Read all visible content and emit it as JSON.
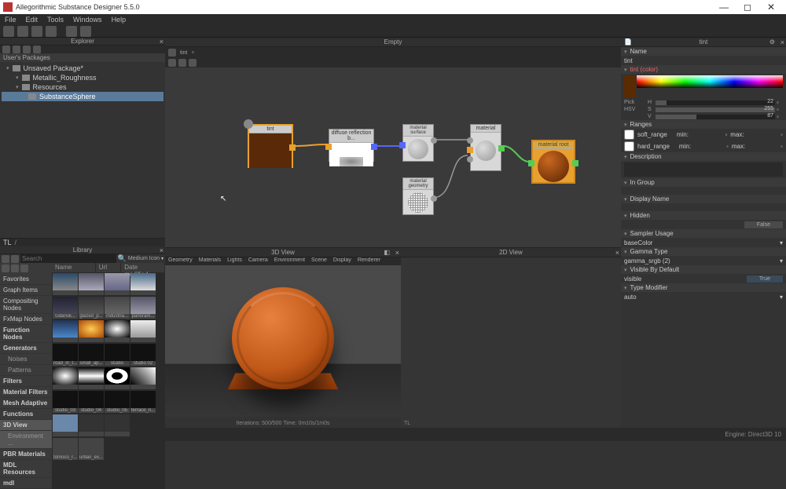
{
  "app": {
    "title": "Allegorithmic Substance Designer 5.5.0"
  },
  "menu": [
    "File",
    "Edit",
    "Tools",
    "Windows",
    "Help"
  ],
  "explorer": {
    "title": "Explorer",
    "section": "User's Packages",
    "items": [
      {
        "label": "Unsaved Package*",
        "level": 1
      },
      {
        "label": "Metallic_Roughness",
        "level": 2
      },
      {
        "label": "Resources",
        "level": 2
      },
      {
        "label": "SubstanceSphere",
        "level": 3,
        "selected": true
      }
    ],
    "tl_label": "TL"
  },
  "library": {
    "title": "Library",
    "search_placeholder": "Search",
    "view_mode": "Medium Icon",
    "columns": [
      "Name",
      "Url",
      "Date modified"
    ],
    "cats": [
      {
        "label": "Favorites"
      },
      {
        "label": "Graph Items"
      },
      {
        "label": "Compositing Nodes"
      },
      {
        "label": "FxMap Nodes"
      },
      {
        "label": "Function Nodes",
        "bold": true
      },
      {
        "label": "Generators",
        "bold": true
      },
      {
        "label": "Noises",
        "sub": true
      },
      {
        "label": "Patterns",
        "sub": true
      },
      {
        "label": "Filters",
        "bold": true
      },
      {
        "label": "Material Filters",
        "bold": true
      },
      {
        "label": "Mesh Adaptive",
        "bold": true
      },
      {
        "label": "Functions",
        "bold": true
      },
      {
        "label": "3D View",
        "bold": true,
        "sel": true
      },
      {
        "label": "Environment ...",
        "sub": true,
        "sel": true
      },
      {
        "label": "PBR Materials",
        "bold": true
      },
      {
        "label": "MDL Resources",
        "bold": true
      },
      {
        "label": "mdl",
        "bold": true
      }
    ],
    "rows": [
      [
        {
          "bg": "linear-gradient(#2a4a6a,#888)",
          "lbl": ""
        },
        {
          "bg": "linear-gradient(#556,#aab)",
          "lbl": ""
        },
        {
          "bg": "linear-gradient(#99a,#668)",
          "lbl": ""
        },
        {
          "bg": "linear-gradient(#4a6a8a,#ddd)",
          "lbl": ""
        }
      ],
      [
        {
          "bg": "linear-gradient(#223,#445)",
          "lbl": "Gdansk..."
        },
        {
          "bg": "linear-gradient(#333,#555)",
          "lbl": "glazed_p..."
        },
        {
          "bg": "linear-gradient(#444,#666)",
          "lbl": "industria..."
        },
        {
          "bg": "linear-gradient(#556,#99a)",
          "lbl": "panoram..."
        }
      ],
      [
        {
          "bg": "linear-gradient(#223355,#4a88cc)",
          "lbl": ""
        },
        {
          "bg": "radial-gradient(#ffcc55,#aa4400)",
          "lbl": ""
        },
        {
          "bg": "radial-gradient(#fff,#000)",
          "lbl": ""
        },
        {
          "bg": "linear-gradient(#eee,#999)",
          "lbl": ""
        }
      ],
      [
        {
          "bg": "#111",
          "lbl": "road_in_t..."
        },
        {
          "bg": "#111",
          "lbl": "small_ap..."
        },
        {
          "bg": "#111",
          "lbl": "studio"
        },
        {
          "bg": "#111",
          "lbl": "studio 02"
        }
      ],
      [
        {
          "bg": "radial-gradient(#fff,#000)",
          "lbl": ""
        },
        {
          "bg": "linear-gradient(#000,#fff,#000)",
          "lbl": ""
        },
        {
          "bg": "radial-gradient(#000 30%,#fff 31%,#fff 60%,#000 61%)",
          "lbl": ""
        },
        {
          "bg": "linear-gradient(45deg,#000,#fff)",
          "lbl": ""
        }
      ],
      [
        {
          "bg": "#111",
          "lbl": "studio_03"
        },
        {
          "bg": "#111",
          "lbl": "studio_04"
        },
        {
          "bg": "#111",
          "lbl": "studio_05"
        },
        {
          "bg": "#111",
          "lbl": "terrace_n..."
        }
      ],
      [
        {
          "bg": "#6a88aa",
          "lbl": ""
        },
        {
          "bg": "#333",
          "lbl": ""
        },
        {
          "bg": "#333",
          "lbl": ""
        },
        {
          "bg": "",
          "lbl": ""
        }
      ],
      [
        {
          "bg": "",
          "lbl": "tomoco_r..."
        },
        {
          "bg": "",
          "lbl": "urban_ex..."
        },
        {
          "bg": "",
          "lbl": ""
        },
        {
          "bg": "",
          "lbl": ""
        }
      ]
    ]
  },
  "graph": {
    "title": "Empty",
    "tab": "tint",
    "nodes": {
      "tint": "tint",
      "diffuse": "diffuse reflection b...",
      "surface": "material surface",
      "geometry": "material geometry",
      "material": "material",
      "root": "material root"
    }
  },
  "view3d": {
    "title": "3D View",
    "menu": [
      "Geometry",
      "Materials",
      "Lights",
      "Camera",
      "Environment",
      "Scene",
      "Display",
      "Renderer"
    ],
    "status": "Iterations: 500/500    Time: 0m10s/1m0s"
  },
  "view2d": {
    "title": "2D View"
  },
  "props": {
    "title": "tint",
    "name_section": "Name",
    "name_value": "tint",
    "tint_section": "tint (color)",
    "pick": "Pick",
    "hsv": "HSV",
    "h_label": "H",
    "h_val": "22",
    "s_label": "S",
    "s_val": "255",
    "v_label": "V",
    "v_val": "87",
    "ranges_section": "Ranges",
    "soft": "soft_range",
    "hard": "hard_range",
    "min": "min:",
    "max": "max:",
    "desc_section": "Description",
    "group_section": "In Group",
    "display_section": "Display Name",
    "hidden_section": "Hidden",
    "hidden_val": "False",
    "sampler_section": "Sampler Usage",
    "sampler_val": "baseColor",
    "gamma_section": "Gamma Type",
    "gamma_val": "gamma_srgb (2)",
    "visible_section": "Visible By Default",
    "visible_val": "visible",
    "visible_btn": "True",
    "type_section": "Type Modifier",
    "type_val": "auto"
  },
  "status": {
    "engine": "Engine: Direct3D 10"
  }
}
